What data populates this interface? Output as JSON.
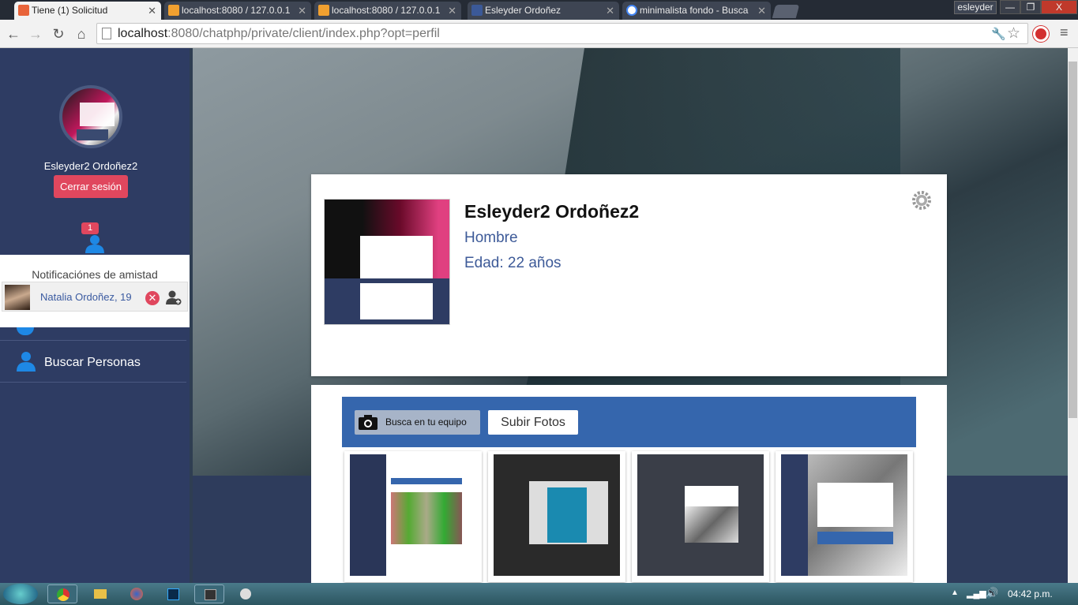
{
  "browser": {
    "tabs": [
      {
        "title": "Tiene (1) Solicitud",
        "active": true,
        "favicon_color": "#e8643a"
      },
      {
        "title": "localhost:8080 / 127.0.0.1",
        "active": false,
        "favicon_color": "#f0a030"
      },
      {
        "title": "localhost:8080 / 127.0.0.1",
        "active": false,
        "favicon_color": "#f0a030"
      },
      {
        "title": "Esleyder Ordoñez",
        "active": false,
        "favicon_color": "#3b5998"
      },
      {
        "title": "minimalista fondo - Busca",
        "active": false,
        "favicon_color": "#4285f4"
      }
    ],
    "user": "esleyder",
    "window_controls": [
      "—",
      "❐",
      "X"
    ],
    "url_host": "localhost",
    "url_path": ":8080/chatphp/private/client/index.php?opt=perfil"
  },
  "sidebar": {
    "user_name": "Esleyder2 Ordoñez2",
    "logout_label": "Cerrar sesión",
    "notification_count": "1",
    "notifications_title": "Notificaciónes de amistad",
    "notification": {
      "name": "Natalia Ordoñez, 19"
    },
    "menu": {
      "search_label": "Buscar Personas"
    }
  },
  "profile": {
    "name": "Esleyder2 Ordoñez2",
    "gender": "Hombre",
    "age": "Edad: 22 años"
  },
  "photos": {
    "browse_label": "Busca en tu equipo",
    "upload_label": "Subir Fotos"
  },
  "taskbar": {
    "clock": "04:42 p.m."
  },
  "colors": {
    "sidebar": "#2e3c63",
    "accent_red": "#e0475e",
    "upload_bar": "#3566ad",
    "link_blue": "#3d5a98"
  }
}
